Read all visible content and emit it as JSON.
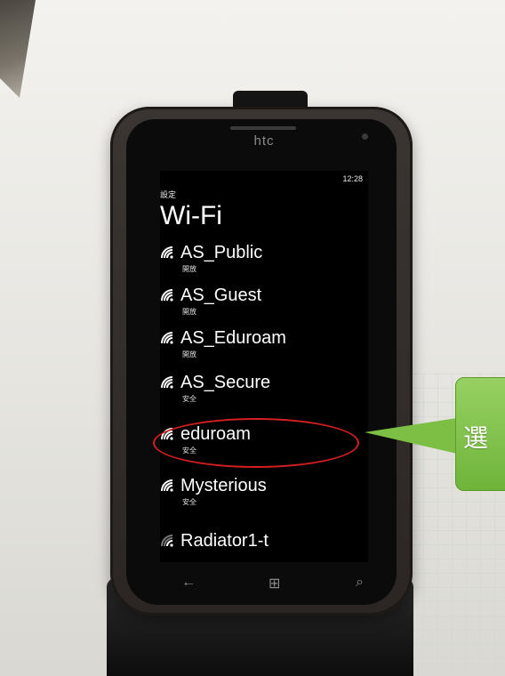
{
  "phone": {
    "brand": "htc",
    "status": {
      "time": "12:28"
    },
    "breadcrumb": "設定",
    "title": "Wi-Fi",
    "networks": [
      {
        "name": "AS_Public",
        "status": "開放",
        "signal": "wifi-strong-icon"
      },
      {
        "name": "AS_Guest",
        "status": "開放",
        "signal": "wifi-strong-icon"
      },
      {
        "name": "AS_Eduroam",
        "status": "開放",
        "signal": "wifi-strong-icon"
      },
      {
        "name": "AS_Secure",
        "status": "安全",
        "signal": "wifi-strong-icon"
      },
      {
        "name": "eduroam",
        "status": "安全",
        "signal": "wifi-strong-icon"
      },
      {
        "name": "Mysterious",
        "status": "安全",
        "signal": "wifi-strong-icon"
      },
      {
        "name": "Radiator1-t",
        "status": "",
        "signal": "wifi-weak-icon"
      }
    ],
    "nav": {
      "back": "←",
      "home": "⊞",
      "search": "⌕"
    }
  },
  "annotation": {
    "callout_text": "選",
    "highlight_color": "#d41f1f",
    "callout_color": "#7cbf44"
  }
}
